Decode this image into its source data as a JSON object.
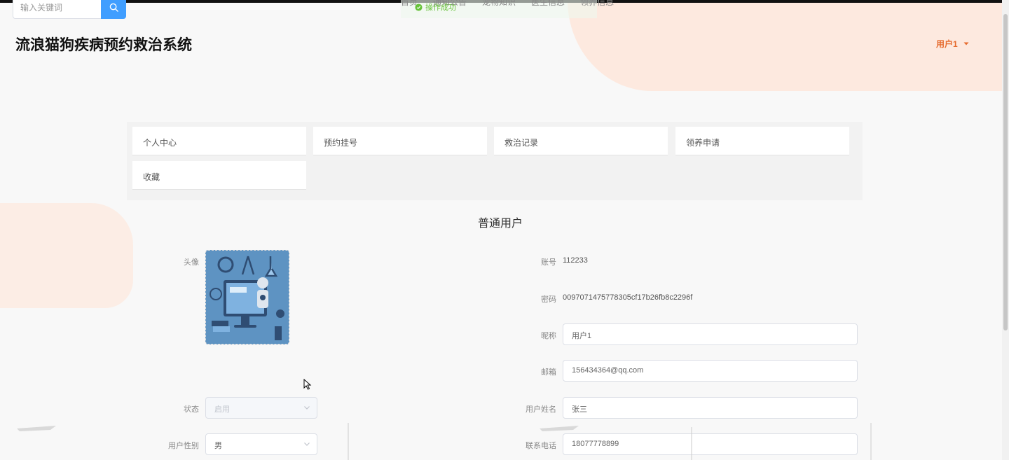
{
  "search": {
    "placeholder": "输入关键词"
  },
  "nav": {
    "items": [
      "首页",
      "通知公告",
      "宠物知识",
      "医生信息",
      "领养信息"
    ]
  },
  "toast": {
    "text": "操作成功"
  },
  "header": {
    "title": "流浪猫狗疾病预约救治系统",
    "user": "用户1"
  },
  "tabs": [
    "个人中心",
    "预约挂号",
    "救治记录",
    "领养申请",
    "收藏"
  ],
  "section": {
    "title": "普通用户"
  },
  "profile": {
    "avatar_label": "头像",
    "status_label": "状态",
    "status_value": "启用",
    "gender_label": "用户性别",
    "gender_value": "男",
    "account_label": "账号",
    "account_value": "112233",
    "password_label": "密码",
    "password_value": "0097071475778305cf17b26fb8c2296f",
    "nickname_label": "昵称",
    "nickname_value": "用户1",
    "email_label": "邮箱",
    "email_value": "156434364@qq.com",
    "name_label": "用户姓名",
    "name_value": "张三",
    "phone_label": "联系电话",
    "phone_value": "18077778899"
  },
  "colors": {
    "accent": "#409eff",
    "user_menu": "#e66b2e",
    "blob": "#fde9df",
    "avatar_bg": "#5e93c2"
  },
  "icons": {
    "search": "search-icon",
    "user_dropdown": "caret-down-icon",
    "select_arrow": "chevron-down-icon",
    "toast": "check-circle-icon",
    "cursor": "mouse-cursor-icon"
  }
}
